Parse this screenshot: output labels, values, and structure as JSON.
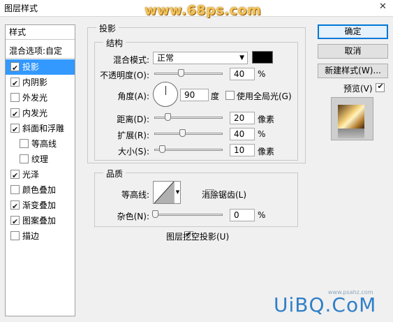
{
  "window": {
    "title": "图层样式",
    "watermark_top": "www.68ps.com",
    "close_glyph": "✕"
  },
  "style_list": {
    "header": "样式",
    "blend_options": "混合选项:自定",
    "items": [
      {
        "label": "投影",
        "checked": true,
        "selected": true,
        "sub": false
      },
      {
        "label": "内阴影",
        "checked": true,
        "selected": false,
        "sub": false
      },
      {
        "label": "外发光",
        "checked": false,
        "selected": false,
        "sub": false
      },
      {
        "label": "内发光",
        "checked": true,
        "selected": false,
        "sub": false
      },
      {
        "label": "斜面和浮雕",
        "checked": true,
        "selected": false,
        "sub": false
      },
      {
        "label": "等高线",
        "checked": false,
        "selected": false,
        "sub": true
      },
      {
        "label": "纹理",
        "checked": false,
        "selected": false,
        "sub": true
      },
      {
        "label": "光泽",
        "checked": true,
        "selected": false,
        "sub": false
      },
      {
        "label": "颜色叠加",
        "checked": false,
        "selected": false,
        "sub": false
      },
      {
        "label": "渐变叠加",
        "checked": true,
        "selected": false,
        "sub": false
      },
      {
        "label": "图案叠加",
        "checked": true,
        "selected": false,
        "sub": false
      },
      {
        "label": "描边",
        "checked": false,
        "selected": false,
        "sub": false
      }
    ]
  },
  "drop_shadow": {
    "section_title": "投影",
    "structure": {
      "title": "结构",
      "blend_mode_label": "混合模式:",
      "blend_mode_value": "正常",
      "shadow_color": "#000000",
      "opacity_label": "不透明度(O):",
      "opacity_value": "40",
      "opacity_unit": "%",
      "angle_label": "角度(A):",
      "angle_value": "90",
      "angle_unit": "度",
      "global_light_label": "使用全局光(G)",
      "global_light_checked": false,
      "distance_label": "距离(D):",
      "distance_value": "20",
      "distance_unit": "像素",
      "spread_label": "扩展(R):",
      "spread_value": "40",
      "spread_unit": "%",
      "size_label": "大小(S):",
      "size_value": "10",
      "size_unit": "像素"
    },
    "quality": {
      "title": "品质",
      "contour_label": "等高线:",
      "anti_alias_label": "消除锯齿(L)",
      "anti_alias_checked": false,
      "noise_label": "杂色(N):",
      "noise_value": "0",
      "noise_unit": "%"
    },
    "knockout_label": "图层挖空投影(U)",
    "knockout_checked": true
  },
  "buttons": {
    "ok": "确定",
    "cancel": "取消",
    "new_style": "新建样式(W)...",
    "preview_label": "预览(V)",
    "preview_checked": true
  },
  "watermark_bottom": "UiBQ.CoM",
  "watermark_small": "www.psahz.com"
}
